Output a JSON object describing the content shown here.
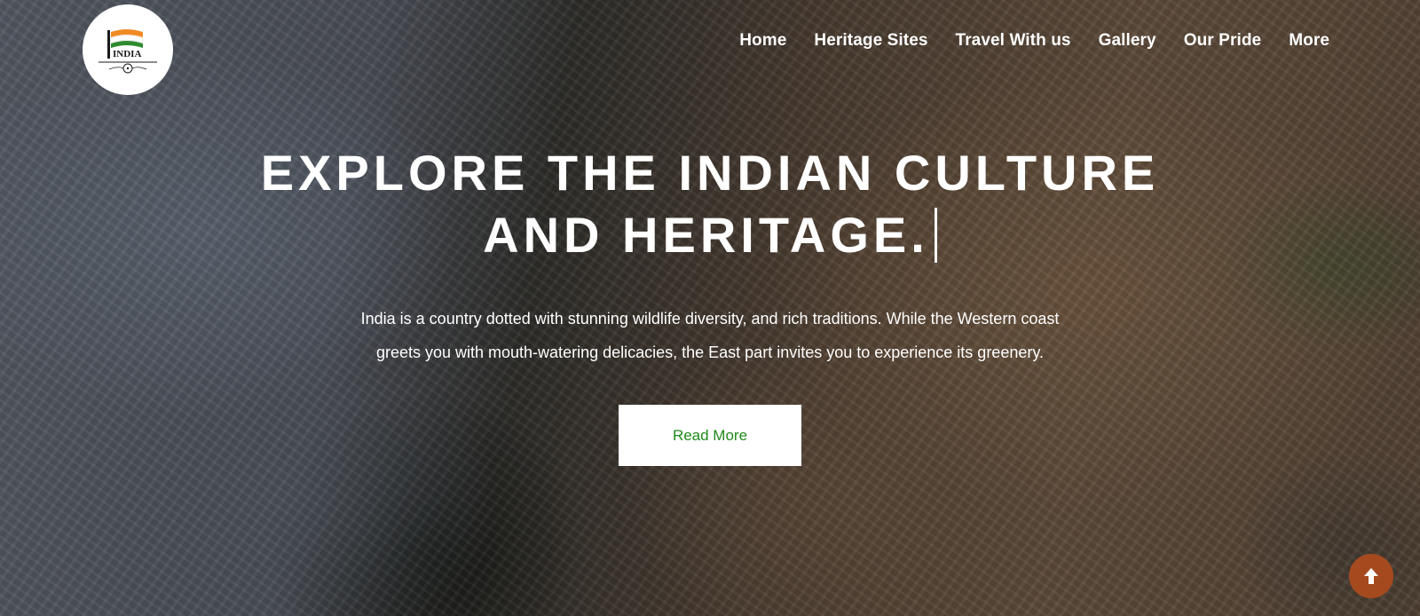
{
  "brand": {
    "logo_text": "INDIA",
    "logo_icon": "india-flag-logo"
  },
  "nav": {
    "items": [
      {
        "label": "Home"
      },
      {
        "label": "Heritage Sites"
      },
      {
        "label": "Travel With us"
      },
      {
        "label": "Gallery"
      },
      {
        "label": "Our Pride"
      },
      {
        "label": "More"
      }
    ]
  },
  "hero": {
    "headline_line1": "EXPLORE THE INDIAN CULTURE",
    "headline_line2": "AND HERITAGE.",
    "description": "India is a country dotted with stunning wildlife diversity, and rich traditions. While the Western coast greets you with mouth-watering delicacies, the East part invites you to experience its greenery.",
    "cta_label": "Read More"
  },
  "back_to_top": {
    "icon": "arrow-up-icon"
  },
  "colors": {
    "cta_text": "#1f8a1a",
    "back_to_top_bg": "#a54a1f",
    "flag_saffron": "#f08a24",
    "flag_green": "#2e8b2e"
  }
}
